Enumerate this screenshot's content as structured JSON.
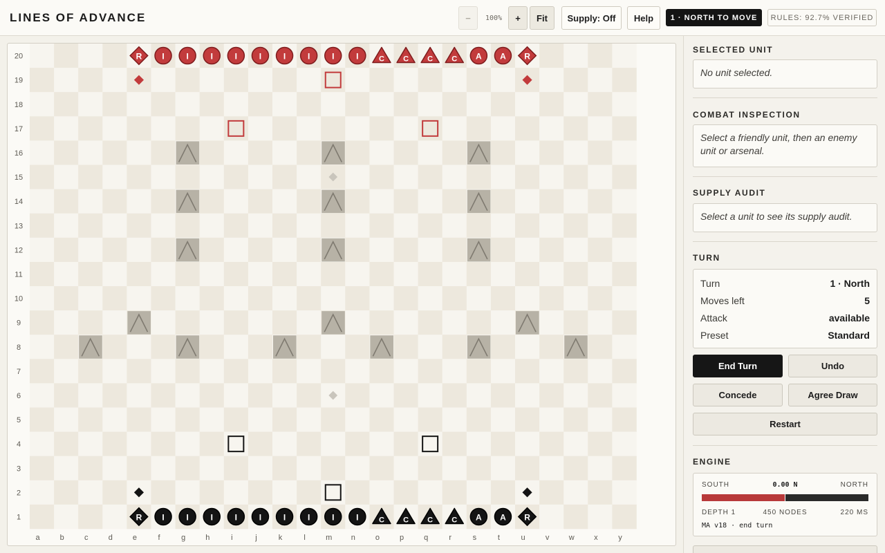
{
  "app": {
    "title": "LINES OF ADVANCE",
    "turn_badge": "1 · NORTH TO MOVE",
    "rules_badge": "RULES: 92.7% VERIFIED"
  },
  "toolbar": {
    "zoom_out_label": "−",
    "zoom_value": "100%",
    "zoom_in_label": "+",
    "fit_label": "Fit",
    "supply_label": "Supply: Off",
    "help_label": "Help"
  },
  "board": {
    "files": [
      "a",
      "b",
      "c",
      "d",
      "e",
      "f",
      "g",
      "h",
      "i",
      "j",
      "k",
      "l",
      "m",
      "n",
      "o",
      "p",
      "q",
      "r",
      "s",
      "t",
      "u",
      "v",
      "w",
      "x",
      "y"
    ],
    "ranks": [
      20,
      19,
      18,
      17,
      16,
      15,
      14,
      13,
      12,
      11,
      10,
      9,
      8,
      7,
      6,
      5,
      4,
      3,
      2,
      1
    ],
    "colors": {
      "light": "#f7f5ef",
      "dark": "#ede8dd",
      "north": "#c23b3c",
      "north_border": "#7e1c1d",
      "south": "#141414",
      "mountain": "#b7b2a6",
      "mountain_line": "#7f7a70",
      "marker": "#c9c5bc"
    },
    "mountains": [
      "g16",
      "m16",
      "s16",
      "g14",
      "m14",
      "s14",
      "g12",
      "m12",
      "s12",
      "e9",
      "m9",
      "u9",
      "c8",
      "g8",
      "k8",
      "o8",
      "s8",
      "w8"
    ],
    "neutral_markers": [
      "m15",
      "m6"
    ],
    "north_pieces": [
      {
        "sq": "e20",
        "type": "diamond",
        "label": "R"
      },
      {
        "sq": "f20",
        "type": "circle",
        "label": "I"
      },
      {
        "sq": "g20",
        "type": "circle",
        "label": "I"
      },
      {
        "sq": "h20",
        "type": "circle",
        "label": "I"
      },
      {
        "sq": "i20",
        "type": "circle",
        "label": "I"
      },
      {
        "sq": "j20",
        "type": "circle",
        "label": "I"
      },
      {
        "sq": "k20",
        "type": "circle",
        "label": "I"
      },
      {
        "sq": "l20",
        "type": "circle",
        "label": "I"
      },
      {
        "sq": "m20",
        "type": "circle",
        "label": "I"
      },
      {
        "sq": "n20",
        "type": "circle",
        "label": "I"
      },
      {
        "sq": "o20",
        "type": "triangle",
        "label": "C"
      },
      {
        "sq": "p20",
        "type": "triangle",
        "label": "C"
      },
      {
        "sq": "q20",
        "type": "triangle",
        "label": "C"
      },
      {
        "sq": "r20",
        "type": "triangle",
        "label": "C"
      },
      {
        "sq": "s20",
        "type": "circle",
        "label": "A"
      },
      {
        "sq": "t20",
        "type": "circle",
        "label": "A"
      },
      {
        "sq": "u20",
        "type": "diamond",
        "label": "R"
      },
      {
        "sq": "e19",
        "type": "small-diamond",
        "label": ""
      },
      {
        "sq": "u19",
        "type": "small-diamond",
        "label": ""
      },
      {
        "sq": "m19",
        "type": "square",
        "label": ""
      },
      {
        "sq": "i17",
        "type": "square",
        "label": ""
      },
      {
        "sq": "q17",
        "type": "square",
        "label": ""
      }
    ],
    "south_pieces": [
      {
        "sq": "e1",
        "type": "diamond",
        "label": "R"
      },
      {
        "sq": "f1",
        "type": "circle",
        "label": "I"
      },
      {
        "sq": "g1",
        "type": "circle",
        "label": "I"
      },
      {
        "sq": "h1",
        "type": "circle",
        "label": "I"
      },
      {
        "sq": "i1",
        "type": "circle",
        "label": "I"
      },
      {
        "sq": "j1",
        "type": "circle",
        "label": "I"
      },
      {
        "sq": "k1",
        "type": "circle",
        "label": "I"
      },
      {
        "sq": "l1",
        "type": "circle",
        "label": "I"
      },
      {
        "sq": "m1",
        "type": "circle",
        "label": "I"
      },
      {
        "sq": "n1",
        "type": "circle",
        "label": "I"
      },
      {
        "sq": "o1",
        "type": "triangle",
        "label": "C"
      },
      {
        "sq": "p1",
        "type": "triangle",
        "label": "C"
      },
      {
        "sq": "q1",
        "type": "triangle",
        "label": "C"
      },
      {
        "sq": "r1",
        "type": "triangle",
        "label": "C"
      },
      {
        "sq": "s1",
        "type": "circle",
        "label": "A"
      },
      {
        "sq": "t1",
        "type": "circle",
        "label": "A"
      },
      {
        "sq": "u1",
        "type": "diamond",
        "label": "R"
      },
      {
        "sq": "e2",
        "type": "small-diamond",
        "label": ""
      },
      {
        "sq": "u2",
        "type": "small-diamond",
        "label": ""
      },
      {
        "sq": "m2",
        "type": "square",
        "label": ""
      },
      {
        "sq": "i4",
        "type": "square",
        "label": ""
      },
      {
        "sq": "q4",
        "type": "square",
        "label": ""
      }
    ]
  },
  "sidebar": {
    "selected_unit": {
      "title": "SELECTED UNIT",
      "text": "No unit selected."
    },
    "combat": {
      "title": "COMBAT INSPECTION",
      "text": "Select a friendly unit, then an enemy unit or arsenal."
    },
    "supply": {
      "title": "SUPPLY AUDIT",
      "text": "Select a unit to see its supply audit."
    },
    "turn": {
      "title": "TURN",
      "rows": [
        {
          "label": "Turn",
          "value": "1 · North"
        },
        {
          "label": "Moves left",
          "value": "5"
        },
        {
          "label": "Attack",
          "value": "available"
        },
        {
          "label": "Preset",
          "value": "Standard"
        }
      ]
    },
    "actions": {
      "end_turn": "End Turn",
      "undo": "Undo",
      "concede": "Concede",
      "agree_draw": "Agree Draw",
      "restart": "Restart"
    },
    "engine": {
      "title": "ENGINE",
      "south_label": "SOUTH",
      "north_label": "NORTH",
      "eval": "0.00 N",
      "eval_fraction_south": 0.5,
      "depth": "DEPTH 1",
      "nodes": "450 NODES",
      "time": "220 MS",
      "pv": "MA v18 · end turn"
    }
  }
}
